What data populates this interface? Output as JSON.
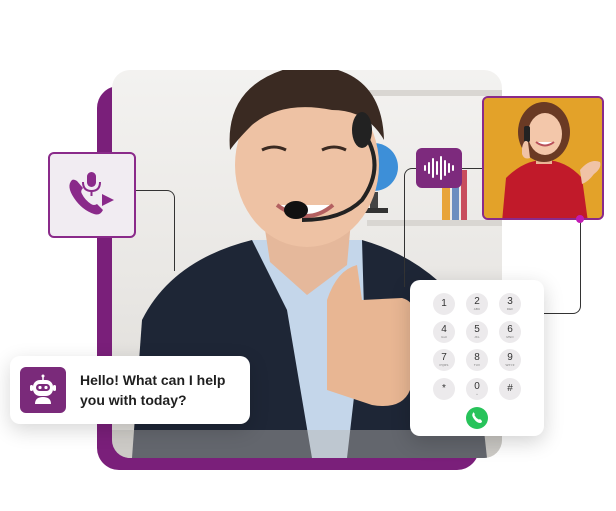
{
  "chat": {
    "message": "Hello! What can I help you with today?"
  },
  "dialer": {
    "keys": [
      {
        "digit": "1",
        "letters": ""
      },
      {
        "digit": "2",
        "letters": "ABC"
      },
      {
        "digit": "3",
        "letters": "DEF"
      },
      {
        "digit": "4",
        "letters": "GHI"
      },
      {
        "digit": "5",
        "letters": "JKL"
      },
      {
        "digit": "6",
        "letters": "MNO"
      },
      {
        "digit": "7",
        "letters": "PQRS"
      },
      {
        "digit": "8",
        "letters": "TUV"
      },
      {
        "digit": "9",
        "letters": "WXYZ"
      },
      {
        "digit": "*",
        "letters": ""
      },
      {
        "digit": "0",
        "letters": "+"
      },
      {
        "digit": "#",
        "letters": ""
      }
    ]
  },
  "colors": {
    "brand_purple": "#7a1f7a",
    "accent_magenta": "#c21bb5",
    "call_green": "#27c35a"
  },
  "icons": {
    "mic_card": "phone-mic-forward-icon",
    "wave_card": "sound-wave-icon",
    "chat_avatar": "robot-icon",
    "call_button": "phone-icon"
  }
}
